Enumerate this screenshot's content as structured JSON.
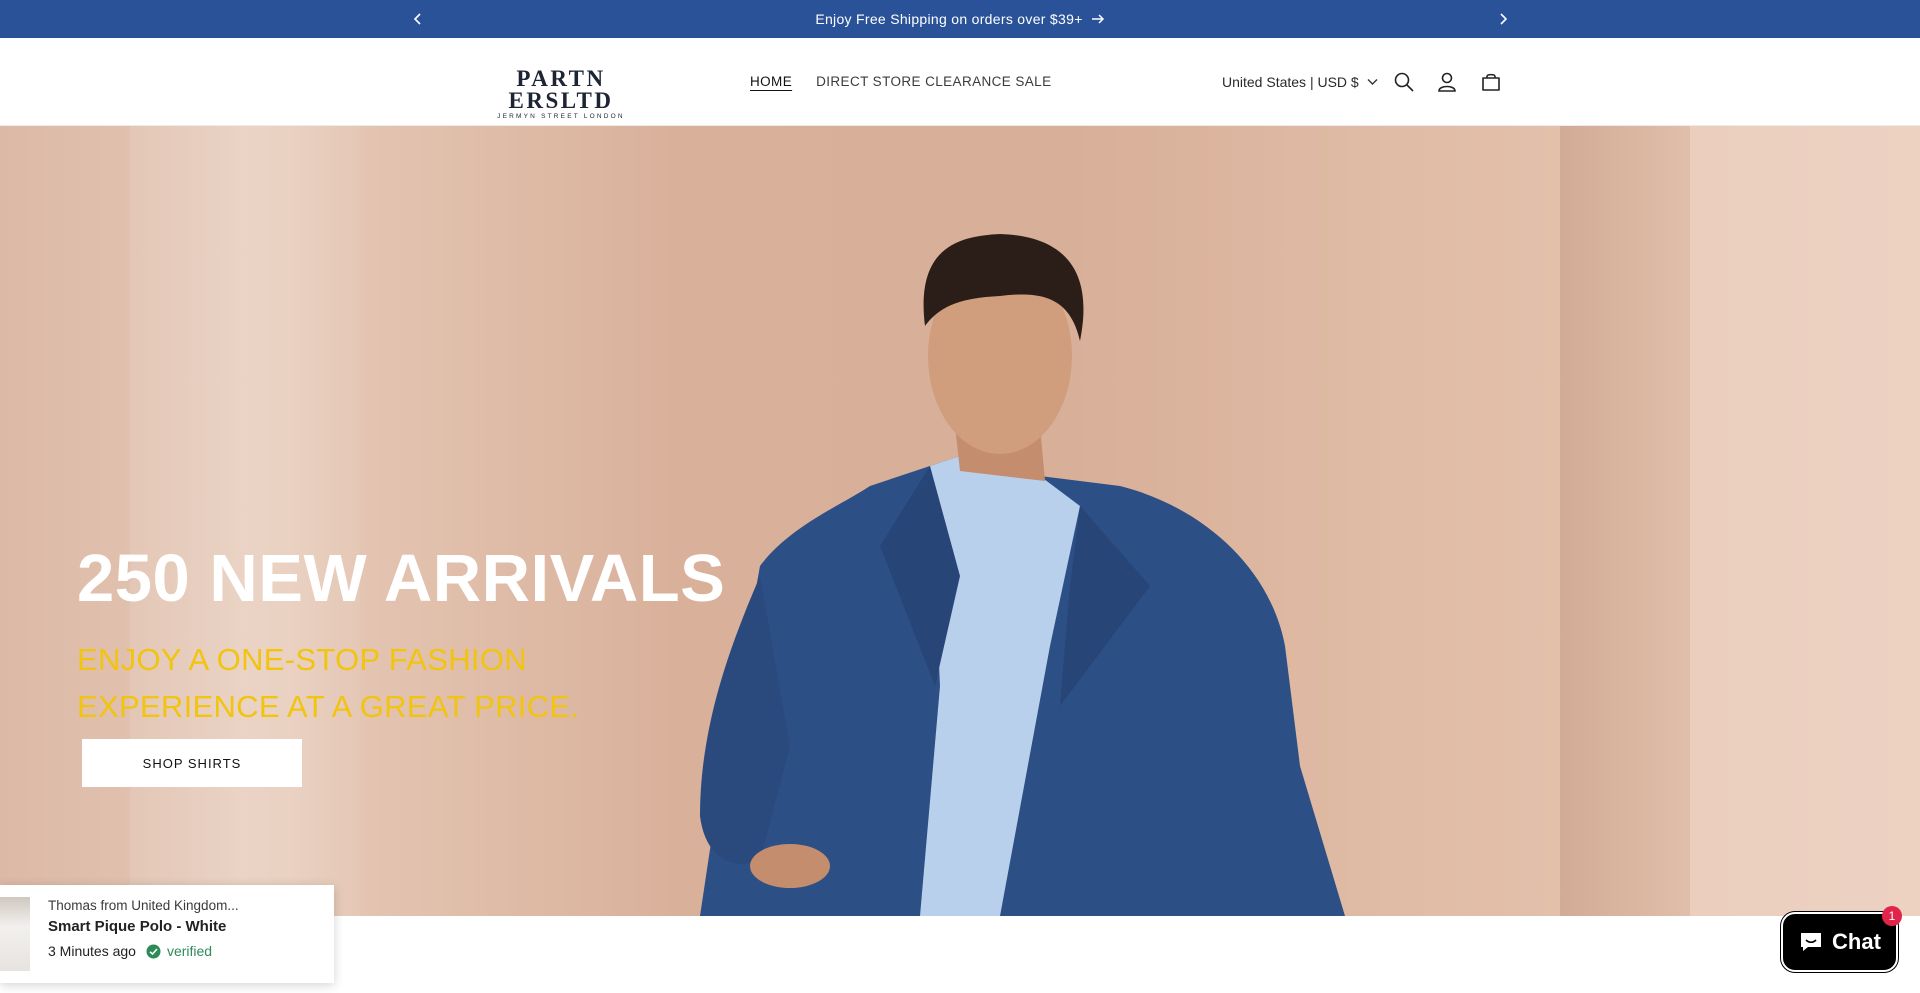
{
  "announcement": {
    "text": "Enjoy Free Shipping on orders over $39+",
    "prev_icon": "chevron-left-icon",
    "next_icon": "chevron-right-icon"
  },
  "header": {
    "logo_main": "PARTN ERSLTD",
    "logo_sub": "JERMYN STREET LONDON",
    "nav": [
      {
        "label": "HOME",
        "active": true
      },
      {
        "label": "DIRECT STORE CLEARANCE SALE",
        "active": false
      }
    ],
    "locale": "United States | USD $",
    "icons": [
      "search-icon",
      "account-icon",
      "cart-icon"
    ]
  },
  "hero": {
    "title": "250 NEW ARRIVALS",
    "subtitle": "ENJOY A ONE-STOP FASHION EXPERIENCE AT A GREAT PRICE.",
    "button": "SHOP SHIRTS",
    "subtitle_color": "#f1c40f"
  },
  "popup": {
    "who": "Thomas from United Kingdom...",
    "product": "Smart Pique Polo - White",
    "time": "3 Minutes ago",
    "verified": "verified"
  },
  "chat": {
    "label": "Chat",
    "badge": "1"
  },
  "colors": {
    "announcement_bg": "#2a5298",
    "verified": "#2e8b57",
    "chat_badge": "#e0244a"
  }
}
